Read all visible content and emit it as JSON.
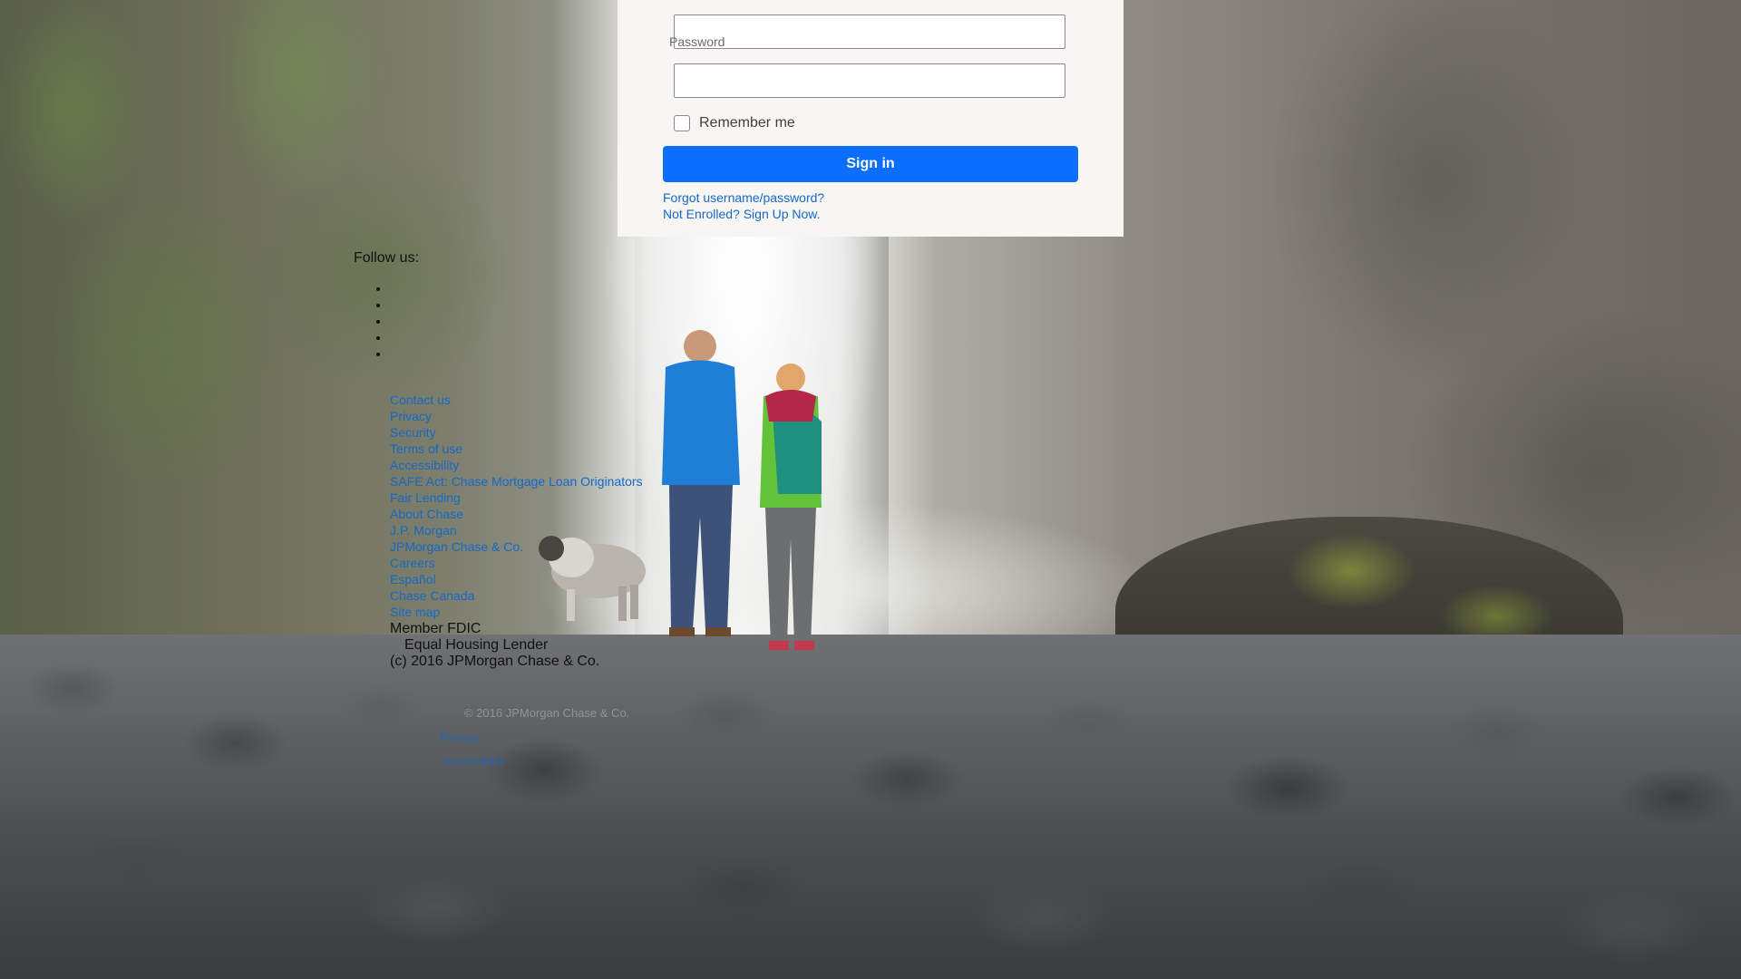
{
  "login": {
    "username_value": "",
    "password_label": "Password",
    "password_value": "",
    "remember_label": "Remember me",
    "remember_checked": false,
    "signin_label": "Sign in",
    "forgot_link": "Forgot username/password?",
    "enroll_link": "Not Enrolled? Sign Up Now."
  },
  "footer": {
    "follow_label": "Follow us:",
    "social_icons": [
      "facebook-icon",
      "instagram-icon",
      "twitter-icon",
      "youtube-icon",
      "linkedin-icon"
    ],
    "links": [
      "Contact us",
      "Privacy",
      "Security",
      "Terms of use",
      "Accessibility",
      "SAFE Act: Chase Mortgage Loan Originators",
      "Fair Lending",
      "About Chase",
      "J.P. Morgan",
      "JPMorgan Chase & Co.",
      "Careers",
      "Español",
      "Chase Canada",
      "Site map"
    ],
    "member_fdic": "Member FDIC",
    "equal_housing": "Equal Housing Lender",
    "copyright": "(c) 2016 JPMorgan Chase & Co.",
    "sub_copyright": "© 2016 JPMorgan Chase & Co.",
    "sub_links": [
      "Privacy",
      "Accessibility"
    ]
  },
  "colors": {
    "panel_bg": "#f8f6f3",
    "signin_button": "#0b6efd",
    "link": "#1569c7"
  }
}
